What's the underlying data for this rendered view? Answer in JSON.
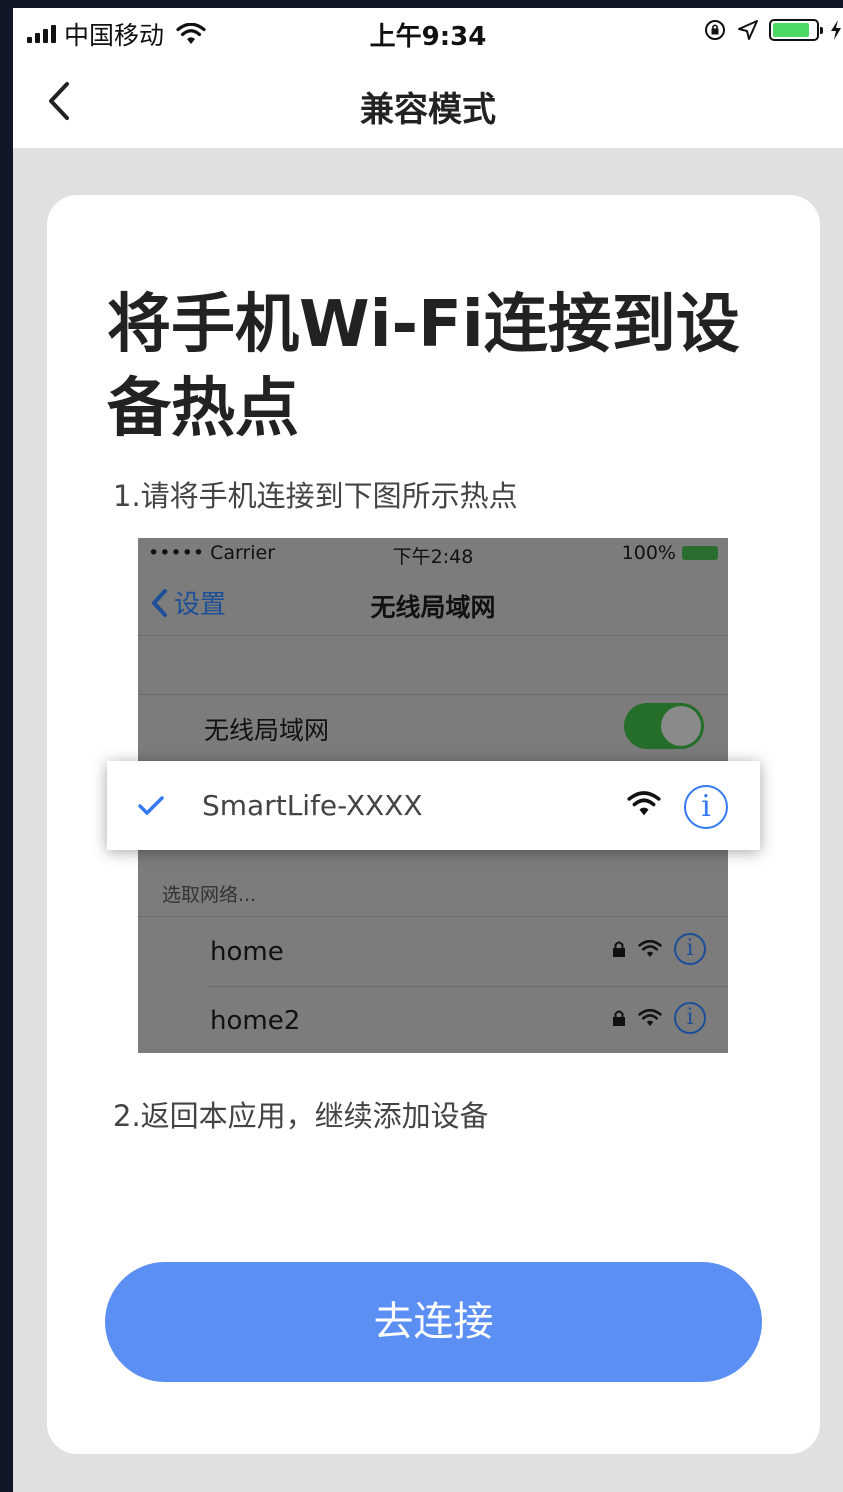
{
  "status_bar": {
    "carrier": "中国移动",
    "time": "上午9:34"
  },
  "nav": {
    "title": "兼容模式"
  },
  "card": {
    "heading": "将手机Wi-Fi连接到设备热点",
    "step1": "1.请将手机连接到下图所示热点",
    "step2": "2.返回本应用，继续添加设备",
    "button_label": "去连接"
  },
  "illustration": {
    "status": {
      "carrier": "••••• Carrier",
      "time": "下午2:48",
      "battery": "100%"
    },
    "back_label": "设置",
    "title": "无线局域网",
    "wlan_label": "无线局域网",
    "wlan_toggle_on": true,
    "section_label": "选取网络...",
    "selected_network": "SmartLife-XXXX",
    "networks": [
      "home",
      "home2"
    ],
    "accent_color": "#3478f6"
  }
}
